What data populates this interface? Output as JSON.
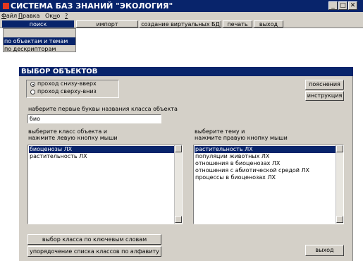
{
  "window": {
    "title": "СИСТЕМА БАЗ ЗНАНИЙ \"ЭКОЛОГИЯ\"",
    "controls": [
      "minimize",
      "maximize",
      "close"
    ]
  },
  "menubar": {
    "items": [
      {
        "label": "Файл",
        "hotkey": "Ф",
        "rest": "айл"
      },
      {
        "label": "Правка",
        "hotkey": "П",
        "rest": "равка"
      },
      {
        "label": "Окно",
        "pre": "Ок",
        "hotkey": "н",
        "rest": "о"
      },
      {
        "label": "?",
        "hotkey": "?",
        "rest": ""
      }
    ]
  },
  "toolbar": {
    "tabs": [
      "поиск",
      "импорт",
      "создание виртуальных БД",
      "печать",
      "выход"
    ],
    "active": "поиск"
  },
  "dropdown": {
    "items": [
      "по объектам и темам",
      "по дескрипторам"
    ],
    "selected": "по объектам и темам"
  },
  "dialog": {
    "title": "ВЫБОР ОБЪЕКТОВ",
    "radio": {
      "options": [
        "проход снизу-вверх",
        "проход сверху-вниз"
      ],
      "selected": "проход снизу-вверх"
    },
    "buttons": {
      "explain": "пояснения",
      "instructions": "инструкция",
      "by_keywords": "выбор класса по ключевым словам",
      "sort_alpha": "упорядочение списка  классов по алфавиту",
      "exit": "выход"
    },
    "search": {
      "label": "наберите первые буквы названия класса объекта",
      "value": "био"
    },
    "class_list": {
      "label_line1": "выберите класс объекта и",
      "label_line2": "нажмите левую кнопку мыши",
      "items": [
        "биоценозы ЛХ",
        "растительность ЛХ"
      ],
      "selected": "биоценозы ЛХ"
    },
    "topic_list": {
      "label_line1": "выберите тему и",
      "label_line2": "нажмите правую кнопку мыши",
      "items": [
        "растительность ЛХ",
        "популяции животных ЛХ",
        "отношения в биоценозах ЛХ",
        "отношения с абиотической средой ЛХ",
        "процессы в биоценозах ЛХ"
      ],
      "selected": "растительность ЛХ"
    }
  }
}
